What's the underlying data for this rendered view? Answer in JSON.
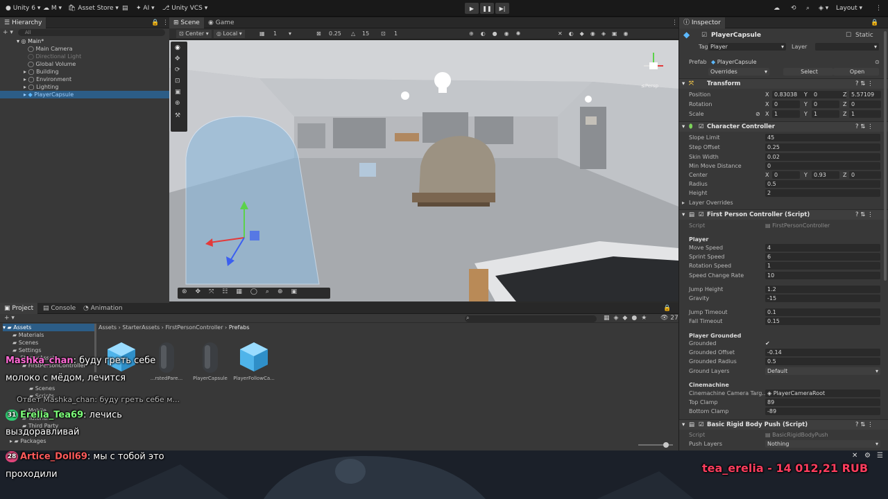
{
  "toolbar": {
    "account": "Unity 6",
    "org": "M",
    "asset_store": "Asset Store",
    "ai": "AI",
    "vcs": "Unity VCS",
    "layout": "Layout"
  },
  "hierarchy": {
    "tab": "Hierarchy",
    "search_placeholder": "All",
    "scene": "Main*",
    "items": [
      "Main Camera",
      "Directional Light",
      "Global Volume",
      "Building",
      "Environment",
      "Lighting",
      "PlayerCapsule"
    ]
  },
  "scene_view": {
    "tabs": [
      "Scene",
      "Game"
    ],
    "pivot": "Center",
    "space": "Local",
    "grid_value": "1",
    "snap_value": "0.25",
    "rotate_snap": "15",
    "scale_snap": "1",
    "persp_label": "≤Persp"
  },
  "inspector": {
    "tab": "Inspector",
    "object_name": "PlayerCapsule",
    "static_label": "Static",
    "tag_label": "Tag",
    "tag_value": "Player",
    "layer_label": "Layer",
    "prefab_label": "Prefab",
    "prefab_name": "PlayerCapsule",
    "overrides": "Overrides",
    "select": "Select",
    "open": "Open",
    "transform": {
      "title": "Transform",
      "position_label": "Position",
      "position": [
        "0.83038",
        "0",
        "5.57109"
      ],
      "rotation_label": "Rotation",
      "rotation": [
        "0",
        "0",
        "0"
      ],
      "scale_label": "Scale",
      "scale": [
        "1",
        "1",
        "1"
      ]
    },
    "character_controller": {
      "title": "Character Controller",
      "rows": [
        {
          "label": "Slope Limit",
          "value": "45"
        },
        {
          "label": "Step Offset",
          "value": "0.25"
        },
        {
          "label": "Skin Width",
          "value": "0.02"
        },
        {
          "label": "Min Move Distance",
          "value": "0"
        }
      ],
      "center_label": "Center",
      "center": [
        "0",
        "0.93",
        "0"
      ],
      "radius_label": "Radius",
      "radius": "0.5",
      "height_label": "Height",
      "height": "2",
      "layer_overrides": "Layer Overrides"
    },
    "fps_controller": {
      "title": "First Person Controller (Script)",
      "script_label": "Script",
      "script_value": "FirstPersonController",
      "player_header": "Player",
      "player_rows": [
        {
          "label": "Move Speed",
          "value": "4"
        },
        {
          "label": "Sprint Speed",
          "value": "6"
        },
        {
          "label": "Rotation Speed",
          "value": "1"
        },
        {
          "label": "Speed Change Rate",
          "value": "10"
        },
        {
          "label": "Jump Height",
          "value": "1.2"
        },
        {
          "label": "Gravity",
          "value": "-15"
        },
        {
          "label": "Jump Timeout",
          "value": "0.1"
        },
        {
          "label": "Fall Timeout",
          "value": "0.15"
        }
      ],
      "grounded_header": "Player Grounded",
      "grounded_label": "Grounded",
      "grounded_rows": [
        {
          "label": "Grounded Offset",
          "value": "-0.14"
        },
        {
          "label": "Grounded Radius",
          "value": "0.5"
        }
      ],
      "ground_layers_label": "Ground Layers",
      "ground_layers_value": "Default",
      "cinemachine_header": "Cinemachine",
      "cam_target_label": "Cinemachine Camera Targ...",
      "cam_target_value": "PlayerCameraRoot",
      "cine_rows": [
        {
          "label": "Top Clamp",
          "value": "89"
        },
        {
          "label": "Bottom Clamp",
          "value": "-89"
        }
      ]
    },
    "push": {
      "title": "Basic Rigid Body Push (Script)",
      "script_label": "Script",
      "script_value": "BasicRigidBodyPush",
      "layers_label": "Push Layers",
      "layers_value": "Nothing"
    }
  },
  "project": {
    "tabs": [
      "Project",
      "Console",
      "Animation"
    ],
    "tree": [
      "Assets",
      "Materials",
      "Scenes",
      "Settings",
      "StarterAssets",
      "FirstPersonController",
      "Scenes",
      "Scripts",
      "Mobile",
      "Tutorial...",
      "Third Party",
      "Packages"
    ],
    "breadcrumb": [
      "Assets",
      "StarterAssets",
      "FirstPersonController",
      "Prefabs"
    ],
    "hidden_count": "27",
    "assets": [
      "",
      "...rstedPare...",
      "PlayerCapsule",
      "PlayerFollowCa..."
    ]
  },
  "chat": [
    {
      "nick": "Mashka_chan",
      "color": "#ff6ad5",
      "text": "буду греть себе",
      "line2": "молоко с мёдом, лечится"
    },
    {
      "reply": "Ответ Mashka_chan: буду греть себе м..."
    },
    {
      "badge": "31",
      "badge_color": "#2ecc71",
      "nick": "Erelia_Tea69",
      "color": "#7dff7a",
      "text": "лечись",
      "line2": "выздоравливай"
    },
    {
      "badge": "28",
      "badge_color": "#e0457b",
      "nick": "Artice_Doll69",
      "color": "#ff5a5a",
      "text": "мы с тобой это",
      "line2": "проходили"
    }
  ],
  "donation": "tea_erelia - 14 012,21 RUB"
}
